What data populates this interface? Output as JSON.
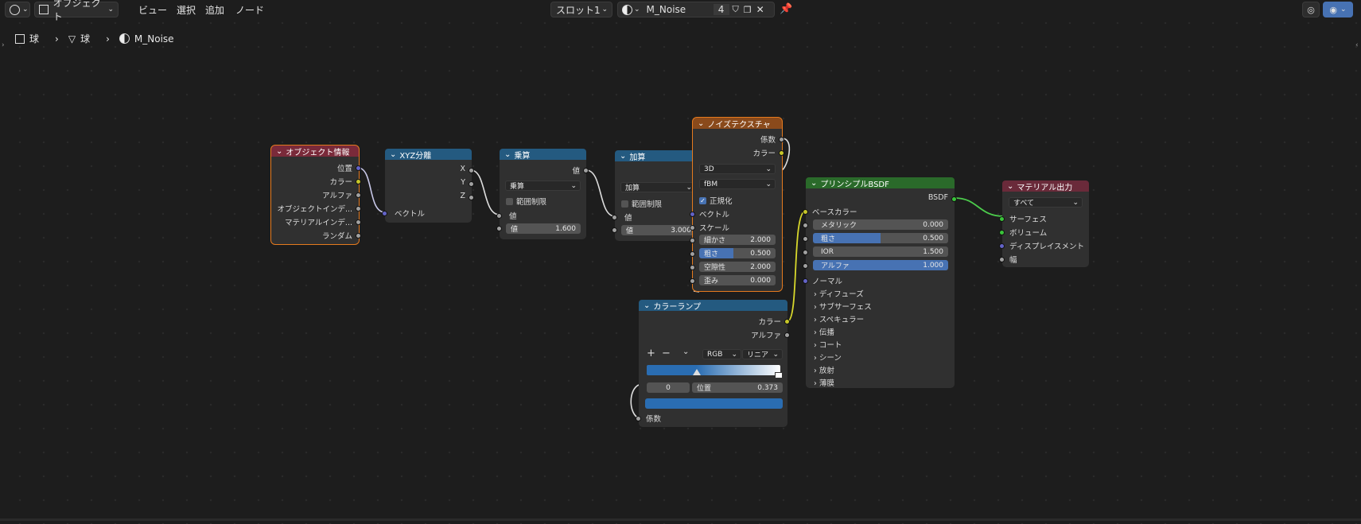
{
  "header": {
    "editor_type": "Shader Editor",
    "mode_label": "オブジェクト",
    "menu": [
      "ビュー",
      "選択",
      "追加",
      "ノード"
    ],
    "slot_label": "スロット1",
    "material_name": "M_Noise",
    "user_count": "4"
  },
  "breadcrumb": [
    "球",
    "球",
    "M_Noise"
  ],
  "nodes": {
    "object_info": {
      "title": "オブジェクト情報",
      "outputs": [
        "位置",
        "カラー",
        "アルファ",
        "オブジェクトインデ...",
        "マテリアルインデ...",
        "ランダム"
      ]
    },
    "separate_xyz": {
      "title": "XYZ分離",
      "outputs": [
        "X",
        "Y",
        "Z"
      ],
      "input": "ベクトル"
    },
    "multiply": {
      "title": "乗算",
      "output": "値",
      "operation": "乗算",
      "clamp_label": "範囲制限",
      "input": "値",
      "value_label": "値",
      "value": "1.600"
    },
    "add": {
      "title": "加算",
      "output": "値",
      "operation": "加算",
      "clamp_label": "範囲制限",
      "input": "値",
      "value_label": "値",
      "value": "3.000"
    },
    "noise": {
      "title": "ノイズテクスチャ",
      "outputs": [
        "係数",
        "カラー"
      ],
      "dimensions": "3D",
      "type": "fBM",
      "normalize_label": "正規化",
      "vector_label": "ベクトル",
      "scale_label": "スケール",
      "fields": [
        {
          "label": "細かさ",
          "value": "2.000",
          "fill": 0
        },
        {
          "label": "粗さ",
          "value": "0.500",
          "fill": 0.5
        },
        {
          "label": "空隙性",
          "value": "2.000",
          "fill": 0
        },
        {
          "label": "歪み",
          "value": "0.000",
          "fill": 0
        }
      ]
    },
    "color_ramp": {
      "title": "カラーランプ",
      "outputs": [
        "カラー",
        "アルファ"
      ],
      "add": "+",
      "remove": "−",
      "menu": "⌄",
      "color_mode": "RGB",
      "interpolation": "リニア",
      "stop_index": "0",
      "pos_label": "位置",
      "pos_value": "0.373",
      "input": "係数"
    },
    "principled": {
      "title": "プリンシプルBSDF",
      "output": "BSDF",
      "base_color": "ベースカラー",
      "fields": [
        {
          "label": "メタリック",
          "value": "0.000",
          "fill": 0
        },
        {
          "label": "粗さ",
          "value": "0.500",
          "fill": 0.5
        },
        {
          "label": "IOR",
          "value": "1.500",
          "fill": 0
        },
        {
          "label": "アルファ",
          "value": "1.000",
          "fill": 1
        }
      ],
      "normal": "ノーマル",
      "panels": [
        "ディフューズ",
        "サブサーフェス",
        "スペキュラー",
        "伝播",
        "コート",
        "シーン",
        "放射",
        "薄膜"
      ]
    },
    "output": {
      "title": "マテリアル出力",
      "target": "すべて",
      "inputs": [
        "サーフェス",
        "ボリューム",
        "ディスプレイスメント",
        "幅"
      ]
    }
  },
  "colors": {
    "input_header": "#7a2a3a",
    "converter_header": "#245a80",
    "texture_header": "#8a4a1b",
    "shader_header": "#2a6a2a",
    "output_header": "#6a2a3a",
    "selection": "#e57a1e",
    "vector_socket": "#6363c7",
    "color_socket": "#c7c729",
    "float_socket": "#a1a1a1",
    "shader_socket": "#3ac43a"
  }
}
